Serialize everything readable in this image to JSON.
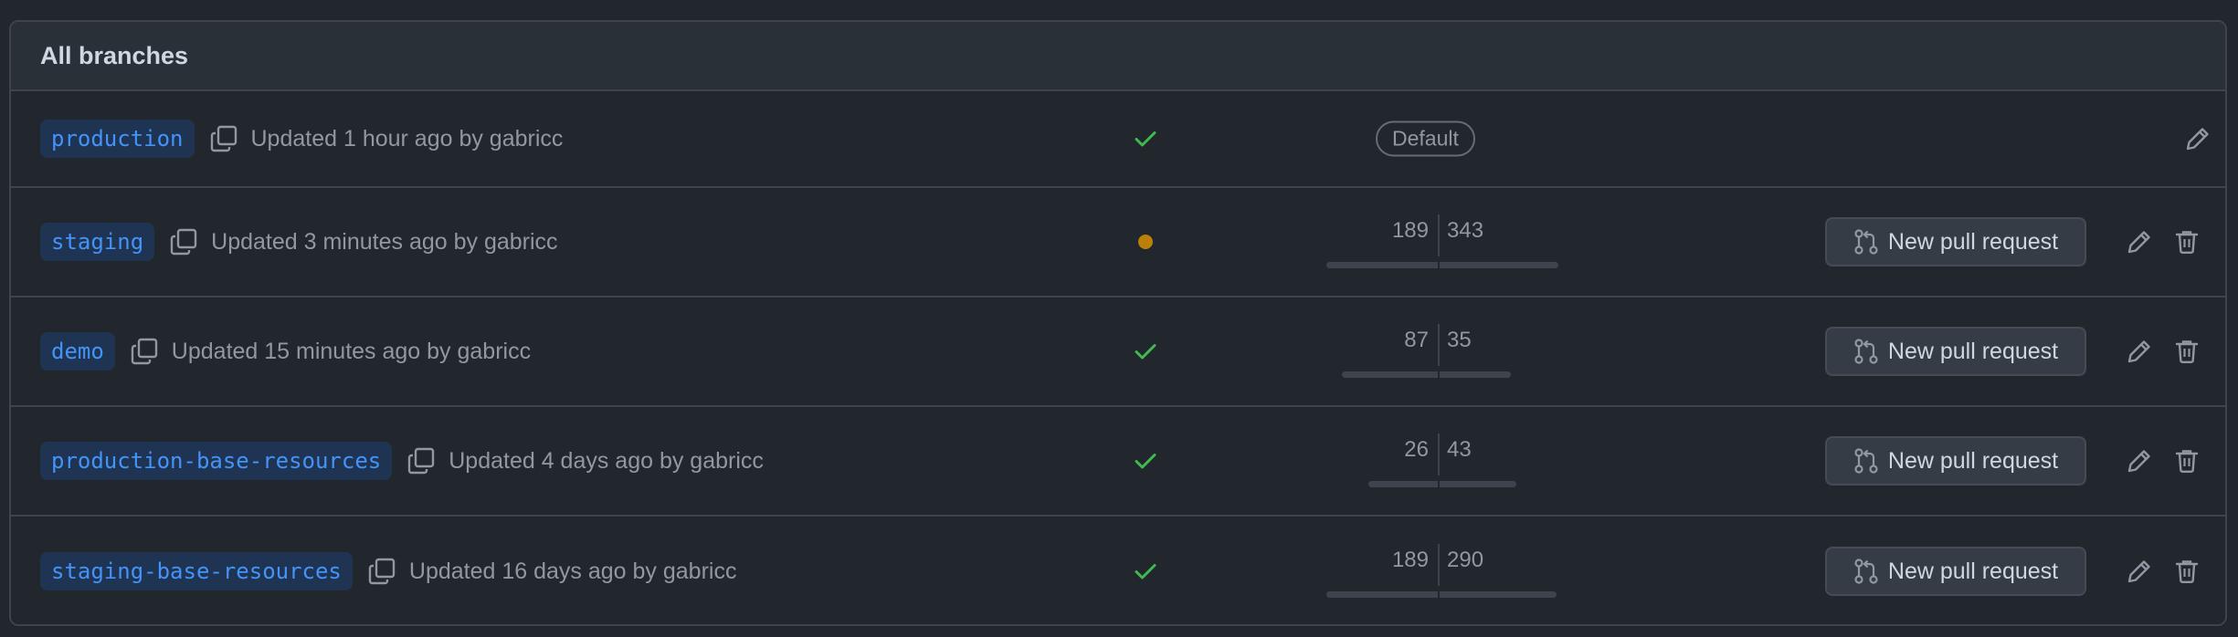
{
  "header": {
    "title": "All branches"
  },
  "labels": {
    "default_badge": "Default",
    "new_pull_request": "New pull request"
  },
  "colors": {
    "branch_text": "#4493f8",
    "check": "#3fb950",
    "pending_dot": "#bb8009",
    "muted_text": "#9198a1"
  },
  "branches": [
    {
      "name": "production",
      "updated": "Updated 1 hour ago by gabricc",
      "status": "success",
      "is_default": true
    },
    {
      "name": "staging",
      "updated": "Updated 3 minutes ago by gabricc",
      "status": "pending",
      "behind": "189",
      "ahead": "343"
    },
    {
      "name": "demo",
      "updated": "Updated 15 minutes ago by gabricc",
      "status": "success",
      "behind": "87",
      "ahead": "35"
    },
    {
      "name": "production-base-resources",
      "updated": "Updated 4 days ago by gabricc",
      "status": "success",
      "behind": "26",
      "ahead": "43"
    },
    {
      "name": "staging-base-resources",
      "updated": "Updated 16 days ago by gabricc",
      "status": "success",
      "behind": "189",
      "ahead": "290"
    }
  ]
}
